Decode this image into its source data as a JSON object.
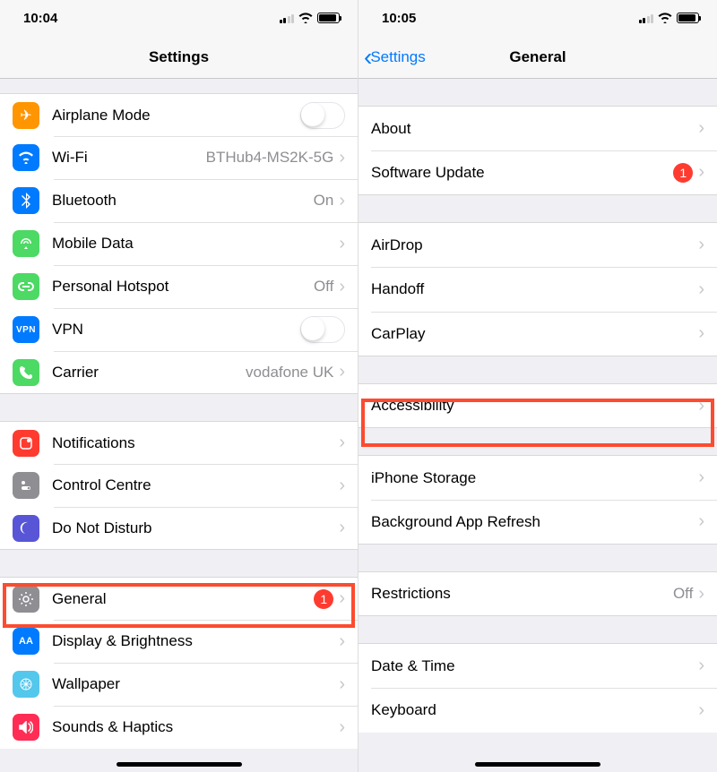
{
  "left": {
    "time": "10:04",
    "title": "Settings",
    "rows": {
      "airplane": "Airplane Mode",
      "wifi": "Wi-Fi",
      "wifi_val": "BTHub4-MS2K-5G",
      "bt": "Bluetooth",
      "bt_val": "On",
      "mobile": "Mobile Data",
      "hotspot": "Personal Hotspot",
      "hotspot_val": "Off",
      "vpn": "VPN",
      "carrier": "Carrier",
      "carrier_val": "vodafone UK",
      "notif": "Notifications",
      "control": "Control Centre",
      "dnd": "Do Not Disturb",
      "general": "General",
      "general_badge": "1",
      "display": "Display & Brightness",
      "wallpaper": "Wallpaper",
      "sounds": "Sounds & Haptics"
    }
  },
  "right": {
    "time": "10:05",
    "back": "Settings",
    "title": "General",
    "rows": {
      "about": "About",
      "software": "Software Update",
      "software_badge": "1",
      "airdrop": "AirDrop",
      "handoff": "Handoff",
      "carplay": "CarPlay",
      "accessibility": "Accessibility",
      "storage": "iPhone Storage",
      "refresh": "Background App Refresh",
      "restrictions": "Restrictions",
      "restrictions_val": "Off",
      "datetime": "Date & Time",
      "keyboard": "Keyboard"
    }
  }
}
